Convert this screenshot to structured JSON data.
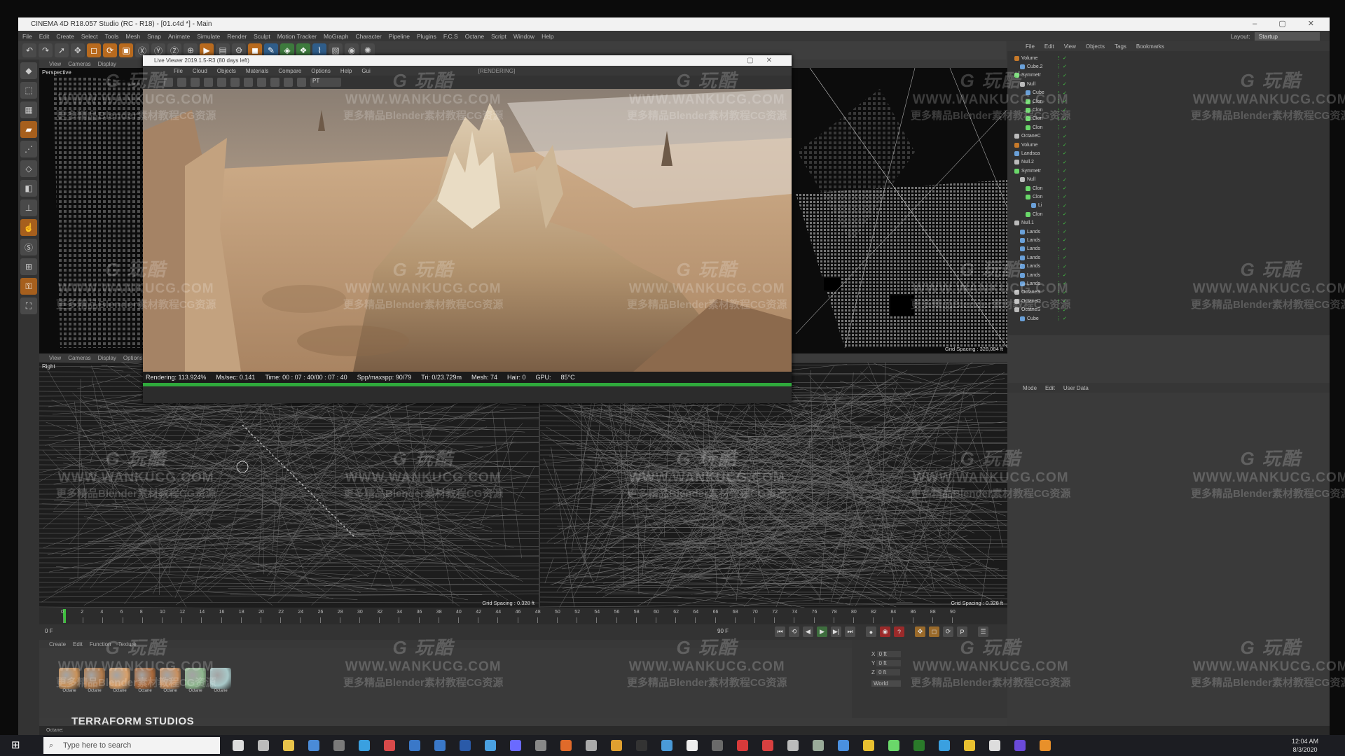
{
  "window": {
    "title": "CINEMA 4D R18.057 Studio (RC - R18) - [01.c4d *] - Main",
    "controls": "– ▢ ✕"
  },
  "menu": [
    "File",
    "Edit",
    "Create",
    "Select",
    "Tools",
    "Mesh",
    "Snap",
    "Animate",
    "Simulate",
    "Render",
    "Sculpt",
    "Motion Tracker",
    "MoGraph",
    "Character",
    "Pipeline",
    "Plugins",
    "F.C.S",
    "Octane",
    "Script",
    "Window",
    "Help"
  ],
  "layout": {
    "label": "Layout:",
    "value": "Startup"
  },
  "viewports": {
    "perspective": {
      "menu": [
        "View",
        "Cameras",
        "Display"
      ],
      "label": "Perspective",
      "grid": "Grid Spacing : 328,084 ft"
    },
    "right": {
      "menu": [
        "View",
        "Cameras",
        "Display",
        "Options"
      ],
      "label": "Right",
      "grid": "Grid Spacing : 0.328 ft"
    },
    "front": {
      "grid": "Grid Spacing : 0.328 ft"
    }
  },
  "live_viewer": {
    "title": "Live Viewer 2019.1.5-R3 (80 days left)",
    "menu": [
      "File",
      "Cloud",
      "Objects",
      "Materials",
      "Compare",
      "Options",
      "Help",
      "Gui"
    ],
    "state": "[RENDERING]",
    "pt": "PT",
    "status": {
      "rendering": "Rendering: 113.924%",
      "ms": "Ms/sec: 0.141",
      "time": "Time: 00 : 07 : 40/00 : 07 : 40",
      "spp": "Spp/maxspp: 90/79",
      "tri": "Tri: 0/23.729m",
      "mesh": "Mesh: 74",
      "hair": "Hair: 0",
      "gpu": "GPU:",
      "temp": "85°C"
    }
  },
  "object_manager": {
    "menu": [
      "File",
      "Edit",
      "View",
      "Objects",
      "Tags",
      "Bookmarks"
    ],
    "rows": [
      {
        "name": "Volume",
        "indent": 0,
        "color": "#c77a2a"
      },
      {
        "name": "Cube.2",
        "indent": 1,
        "color": "#6aa0d8"
      },
      {
        "name": "Symmetr",
        "indent": 0,
        "color": "#6ad86a"
      },
      {
        "name": "Null",
        "indent": 1,
        "color": "#bbbbbb"
      },
      {
        "name": "Cube",
        "indent": 2,
        "color": "#6aa0d8"
      },
      {
        "name": "Clon",
        "indent": 2,
        "color": "#6ad86a"
      },
      {
        "name": "Clon",
        "indent": 2,
        "color": "#6ad86a"
      },
      {
        "name": "Clon",
        "indent": 2,
        "color": "#6ad86a"
      },
      {
        "name": "Clon",
        "indent": 2,
        "color": "#6ad86a"
      },
      {
        "name": "OctaneC",
        "indent": 0,
        "color": "#bbbbbb"
      },
      {
        "name": "Volume",
        "indent": 0,
        "color": "#c77a2a"
      },
      {
        "name": "Landsca",
        "indent": 0,
        "color": "#6aa0d8"
      },
      {
        "name": "Null.2",
        "indent": 0,
        "color": "#bbbbbb"
      },
      {
        "name": "Symmetr",
        "indent": 0,
        "color": "#6ad86a"
      },
      {
        "name": "Null",
        "indent": 1,
        "color": "#bbbbbb"
      },
      {
        "name": "Clon",
        "indent": 2,
        "color": "#6ad86a"
      },
      {
        "name": "Clon",
        "indent": 2,
        "color": "#6ad86a"
      },
      {
        "name": "Li",
        "indent": 3,
        "color": "#6aa0d8"
      },
      {
        "name": "Clon",
        "indent": 2,
        "color": "#6ad86a"
      },
      {
        "name": "Null.1",
        "indent": 0,
        "color": "#bbbbbb"
      },
      {
        "name": "Lands",
        "indent": 1,
        "color": "#6aa0d8"
      },
      {
        "name": "Lands",
        "indent": 1,
        "color": "#6aa0d8"
      },
      {
        "name": "Lands",
        "indent": 1,
        "color": "#6aa0d8"
      },
      {
        "name": "Lands",
        "indent": 1,
        "color": "#6aa0d8"
      },
      {
        "name": "Lands",
        "indent": 1,
        "color": "#6aa0d8"
      },
      {
        "name": "Lands",
        "indent": 1,
        "color": "#6aa0d8"
      },
      {
        "name": "Lands",
        "indent": 1,
        "color": "#6aa0d8"
      },
      {
        "name": "OctaneS",
        "indent": 0,
        "color": "#bbbbbb"
      },
      {
        "name": "OctaneD",
        "indent": 0,
        "color": "#bbbbbb"
      },
      {
        "name": "OctaneS",
        "indent": 0,
        "color": "#bbbbbb"
      },
      {
        "name": "Cube",
        "indent": 1,
        "color": "#6aa0d8"
      }
    ]
  },
  "attributes": {
    "menu": [
      "Mode",
      "Edit",
      "User Data"
    ]
  },
  "timeline": {
    "start": "0 F",
    "end": "90 F",
    "current": "0 F"
  },
  "materials": {
    "menu": [
      "Create",
      "Edit",
      "Function",
      "Texture"
    ],
    "items": [
      {
        "name": "Octane",
        "color": "#c9925a"
      },
      {
        "name": "Octane",
        "color": "#b07a4a"
      },
      {
        "name": "Octane",
        "color": "#d8a06a"
      },
      {
        "name": "Octane",
        "color": "#a8683a"
      },
      {
        "name": "Octane",
        "color": "#c89060"
      },
      {
        "name": "Octane",
        "color": "#8fb88f"
      },
      {
        "name": "Octane",
        "color": "#a8c8c8"
      }
    ]
  },
  "coords": {
    "x": "X",
    "y": "Y",
    "z": "Z",
    "val": "0 ft",
    "mode": "World"
  },
  "brand": "TERRAFORM STUDIOS",
  "status_bar": "Octane:",
  "taskbar": {
    "search": "Type here to search",
    "time": "12:04 AM",
    "date": "8/3/2020"
  },
  "watermark": {
    "logo": "G 玩酷",
    "url": "WWW.WANKUCG.COM",
    "sub": "更多精品Blender素材教程CG资源"
  }
}
